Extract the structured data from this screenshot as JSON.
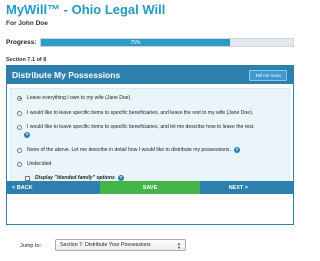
{
  "header": {
    "title": "MyWill™ - Ohio Legal Will",
    "subtitle": "For John Doe"
  },
  "progress": {
    "label": "Progress:",
    "percent_text": "75%",
    "value": 0.75
  },
  "section": {
    "label": "Section 7.1 of 8"
  },
  "panel": {
    "title": "Distribute My Possessions",
    "tell_me_more": "Tell me more",
    "options": [
      {
        "label": "Leave everything I own to my wife (Jane Doe).",
        "selected": true
      },
      {
        "label": "I would like to leave specific items to specific beneficiaries, and leave the rest to my wife (Jane Doe).",
        "selected": false
      },
      {
        "label": "I would like to leave specific items to specific beneficiaries, and let me describe how to leave the rest.",
        "selected": false
      },
      {
        "label": "None of the above.  Let me describe in detail how I would like to distribute my possessions.",
        "selected": false
      },
      {
        "label": "Undecided",
        "selected": false
      }
    ],
    "blended_family_label": "Display \"blended family\" options"
  },
  "nav": {
    "back": "< BACK",
    "save": "SAVE",
    "next": "NEXT >"
  },
  "jump": {
    "label": "Jump to:",
    "selected": "Section 7: Distribute Your Possessions"
  },
  "colors": {
    "brand_title": "#1f9bbf",
    "panel_header": "#2d80ad",
    "save_button": "#44b649",
    "progress_fill": "#2c9cc4"
  }
}
